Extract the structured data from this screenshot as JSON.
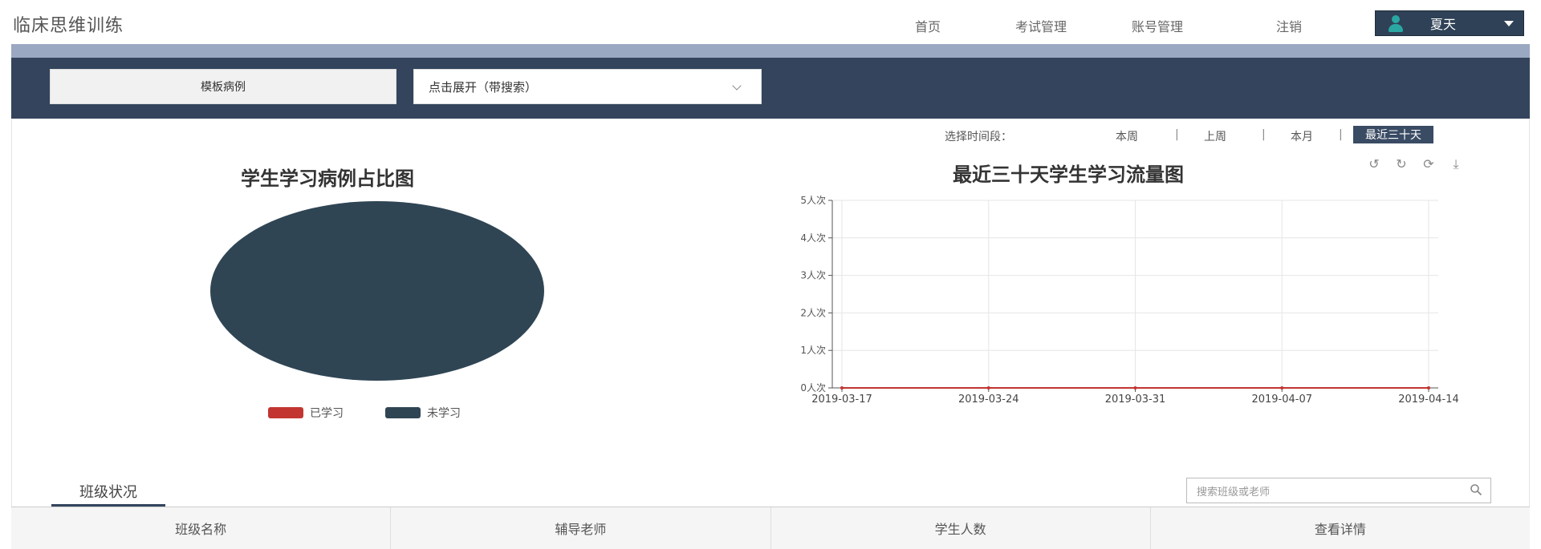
{
  "header": {
    "app_title": "临床思维训练",
    "nav": [
      "首页",
      "考试管理",
      "账号管理",
      "注销"
    ],
    "user_name": "夏天"
  },
  "toolbar": {
    "template_label": "模板病例",
    "select_value": "点击展开（带搜索）"
  },
  "time_selector": {
    "label": "选择时间段：",
    "options": [
      "本周",
      "上周",
      "本月"
    ],
    "active": "最近三十天"
  },
  "pie_chart": {
    "title": "学生学习病例占比图",
    "legend": [
      {
        "label": "已学习",
        "color": "#c23531"
      },
      {
        "label": "未学习",
        "color": "#2f4554"
      }
    ]
  },
  "line_chart": {
    "title": "最近三十天学生学习流量图",
    "tools": [
      "rotate-left-icon",
      "rotate-right-icon",
      "refresh-icon",
      "download-icon"
    ]
  },
  "chart_data": [
    {
      "type": "pie",
      "title": "学生学习病例占比图",
      "categories": [
        "已学习",
        "未学习"
      ],
      "values": [
        0,
        1
      ],
      "colors": [
        "#c23531",
        "#2f4554"
      ],
      "legend_position": "bottom"
    },
    {
      "type": "line",
      "title": "最近三十天学生学习流量图",
      "x": [
        "2019-03-17",
        "2019-03-24",
        "2019-03-31",
        "2019-04-07",
        "2019-04-14"
      ],
      "series": [
        {
          "values": [
            0,
            0,
            0,
            0,
            0
          ],
          "color": "#c23531"
        }
      ],
      "ylim": [
        0,
        5
      ],
      "yticks": [
        "0人次",
        "1人次",
        "2人次",
        "3人次",
        "4人次",
        "5人次"
      ],
      "grid": true
    }
  ],
  "tabs": {
    "class_status": "班级状况"
  },
  "search": {
    "placeholder": "搜索班级或老师"
  },
  "table": {
    "headers": [
      "班级名称",
      "辅导老师",
      "学生人数",
      "查看详情"
    ]
  }
}
